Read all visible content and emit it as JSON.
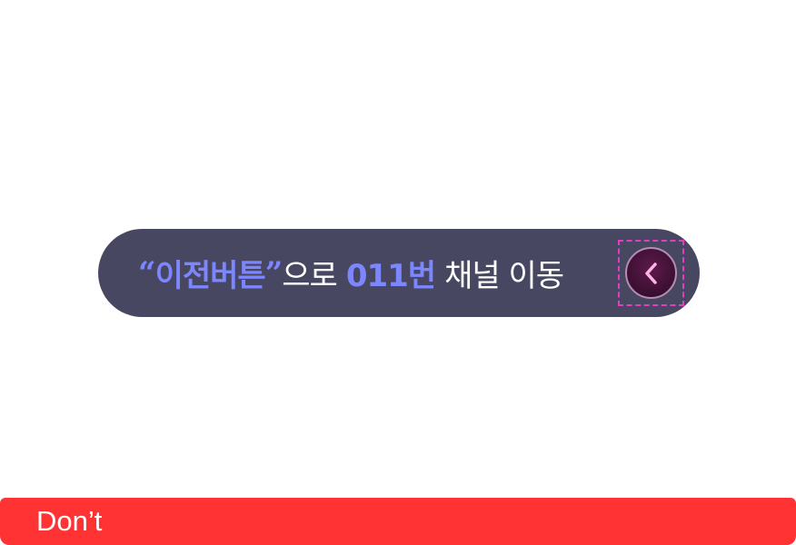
{
  "guide_pill": {
    "open_quote": "“",
    "button_name": "이전버튼",
    "close_quote": "”",
    "particle": "으로",
    "channel_number": "011번",
    "action_text": "채널 이동"
  },
  "prev_button": {
    "icon": "chevron-left-icon",
    "highlight_color": "#e23fc0"
  },
  "footer": {
    "label": "Don’t",
    "color": "#ff3333"
  },
  "colors": {
    "pill_background": "#474761",
    "accent_text": "#7c86ff",
    "button_fill": "#3a0f30",
    "chevron": "#ffb3e6"
  }
}
